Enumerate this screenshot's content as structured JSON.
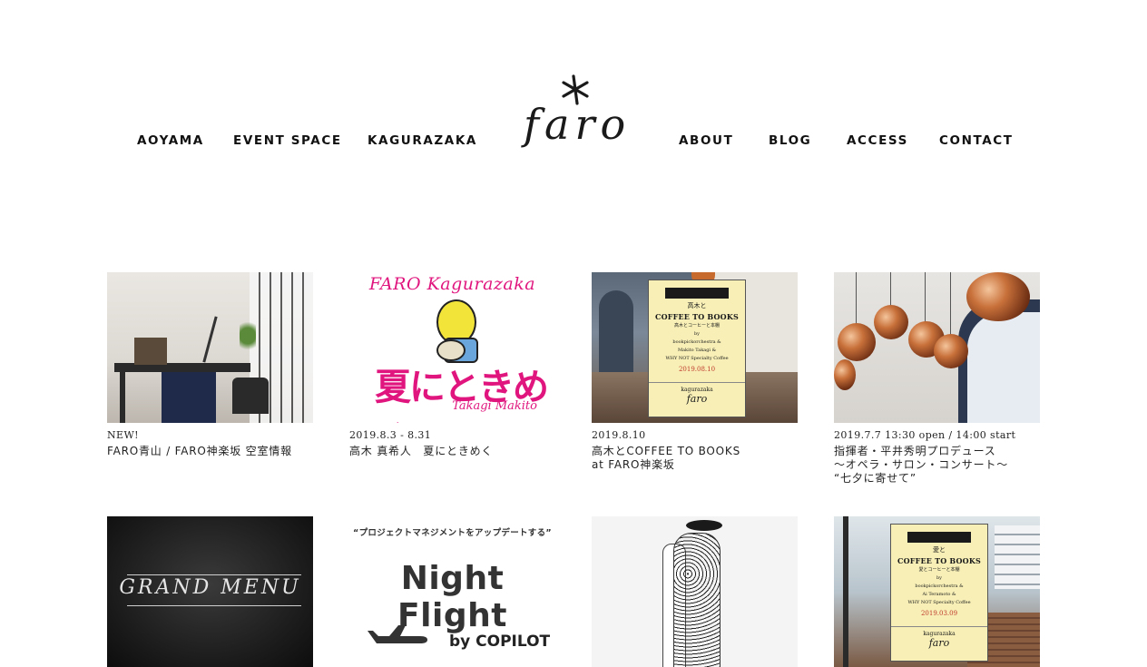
{
  "nav": {
    "left": [
      "AOYAMA",
      "EVENT SPACE",
      "KAGURAZAKA"
    ],
    "right": [
      "ABOUT",
      "BLOG",
      "ACCESS",
      "CONTACT"
    ]
  },
  "logo": {
    "text": "faro",
    "icon": "asterisk-icon"
  },
  "posts": [
    {
      "date": "NEW!",
      "title": "FARO青山 / FARO神楽坂 空室情報",
      "image": "office-desk-photo"
    },
    {
      "date": "2019.8.3 - 8.31",
      "title": "高木 真希人　夏にときめく",
      "image": "kagurazaka-summer-illustration",
      "image_text": {
        "top": "FARO Kagurazaka",
        "main": "夏にときめく",
        "sign": "Takagi Makito"
      }
    },
    {
      "date": "2019.8.10",
      "title": "高木とCOFFEE TO BOOKS\nat FARO神楽坂",
      "image": "coffee-to-books-poster",
      "image_text": {
        "a": "高木と",
        "b": "COFFEE TO BOOKS",
        "c": "高木とコーヒーと本棚",
        "d": "by",
        "e": "bookpickorchestra &",
        "f": "Makito Takagi &",
        "g": "WHY NOT Specialty Coffee",
        "h": "2019.08.10",
        "i": "kagurazaka",
        "j": "faro"
      }
    },
    {
      "date": "2019.7.7 13:30 open / 14:00 start",
      "title": "指揮者・平井秀明プロデュース\n～オペラ・サロン・コンサート～\n“七夕に寄せて”",
      "image": "copper-pendant-lamps-photo"
    },
    {
      "date": "",
      "title": "",
      "image": "grand-menu-photo",
      "image_text": {
        "main": "GRAND MENU"
      }
    },
    {
      "date": "",
      "title": "",
      "image": "night-flight-banner",
      "image_text": {
        "quote": "“プロジェクトマネジメントをアップデートする”",
        "main": "Night Flight",
        "by": "by COPILOT"
      }
    },
    {
      "date": "",
      "title": "",
      "image": "fashion-illustration"
    },
    {
      "date": "",
      "title": "",
      "image": "coffee-to-books-poster-2",
      "image_text": {
        "a": "愛と",
        "b": "COFFEE TO BOOKS",
        "c": "愛とコーヒーと本棚",
        "d": "by",
        "e": "bookpickorchestra &",
        "f": "Ai Teramoto &",
        "g": "WHY NOT Specialty Coffee",
        "h": "2019.03.09",
        "i": "kagurazaka",
        "j": "faro"
      }
    }
  ]
}
